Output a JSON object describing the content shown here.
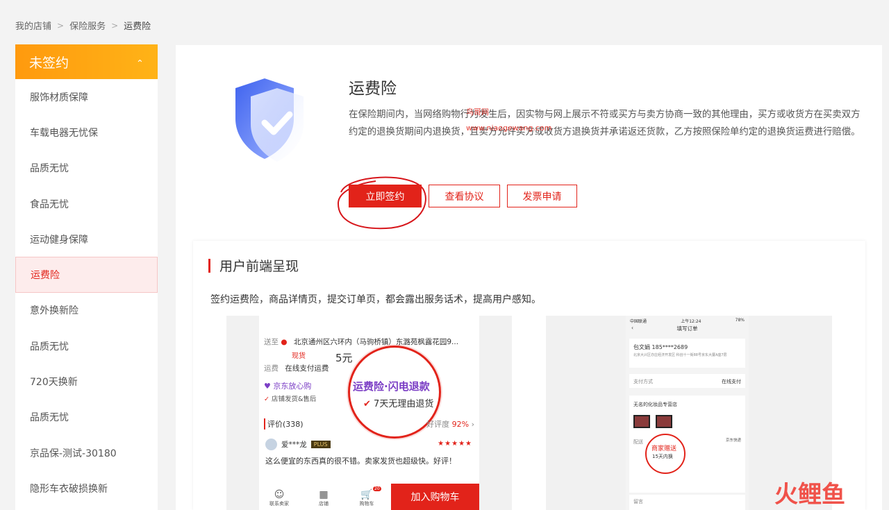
{
  "breadcrumb": {
    "items": [
      "我的店铺",
      "保险服务",
      "运费险"
    ],
    "separator": ">"
  },
  "sidebar": {
    "header_label": "未签约",
    "items": [
      {
        "label": "服饰材质保障",
        "active": false
      },
      {
        "label": "车载电器无忧保",
        "active": false
      },
      {
        "label": "品质无忧",
        "active": false
      },
      {
        "label": "食品无忧",
        "active": false
      },
      {
        "label": "运动健身保障",
        "active": false
      },
      {
        "label": "运费险",
        "active": true
      },
      {
        "label": "意外换新险",
        "active": false
      },
      {
        "label": "品质无忧",
        "active": false
      },
      {
        "label": "720天换新",
        "active": false
      },
      {
        "label": "品质无忧",
        "active": false
      },
      {
        "label": "京品保-测试-30180",
        "active": false
      },
      {
        "label": "隐形车衣破损换新",
        "active": false
      }
    ]
  },
  "product": {
    "title": "运费险",
    "description": "在保险期间内，当网络购物行为发生后，因实物与网上展示不符或买方与卖方协商一致的其他理由，买方或收货方在买卖双方约定的退换货期间内退换货，且卖方允许买方或收货方退换货并承诺返还货款，乙方按照保险单约定的退换货运费进行赔偿。",
    "buttons": {
      "sign": "立即签约",
      "view_agreement": "查看协议",
      "invoice": "发票申请"
    }
  },
  "watermark": {
    "line1": "鸟哥网",
    "line2": "www.niaogewang.com"
  },
  "frontend_section": {
    "title": "用户前端呈现",
    "description": "签约运费险，商品详情页，提交订单页，都会露出服务话术，提高用户感知。"
  },
  "preview_left": {
    "ship_label": "送至",
    "address": "北京通州区六环内（马驹桥镇）东潞苑枫露花园9...",
    "stock": "现货",
    "price": "5元",
    "freight_label": "运费",
    "freight_value": "在线支付运费",
    "jd_tag": "京东放心购",
    "shop_service": "店铺发货&售后",
    "insurance_badge": "运费险·闪电退款",
    "return_policy": "7天无理由退货",
    "review_label": "评价(338)",
    "rating_label": "好评度",
    "rating_value": "92%",
    "reviewer": "爱***龙",
    "plus_badge": "PLUS",
    "review_text": "这么便宜的东西真的很不错。卖家发货也超级快。好评！",
    "bottom_nav": [
      "联系卖家",
      "店铺",
      "购物车"
    ],
    "cart_badge": "20",
    "add_to_cart": "加入购物车"
  },
  "preview_right": {
    "carrier": "中国联通",
    "time": "上午12:24",
    "battery": "78%",
    "nav_title": "填写订单",
    "receiver": "包文娟",
    "phone": "185****2689",
    "address": "北京大兴区亦庄经济开发区 科创十一街88号京东大厦A座7层",
    "payment_label": "支付方式",
    "payment_value": "在线支付",
    "shop_name": "无名的化妆品专营店",
    "delivery_label": "配送",
    "delivery_value": "京东快递",
    "gift_badge": "商家赠送",
    "gift_sub": "15天内换",
    "memo_label": "留言"
  },
  "brand_logo": {
    "text": "火鲤鱼"
  },
  "colors": {
    "accent_red": "#e2231a",
    "header_orange": "#ffa010",
    "shield_blue": "#4a6cf0"
  }
}
